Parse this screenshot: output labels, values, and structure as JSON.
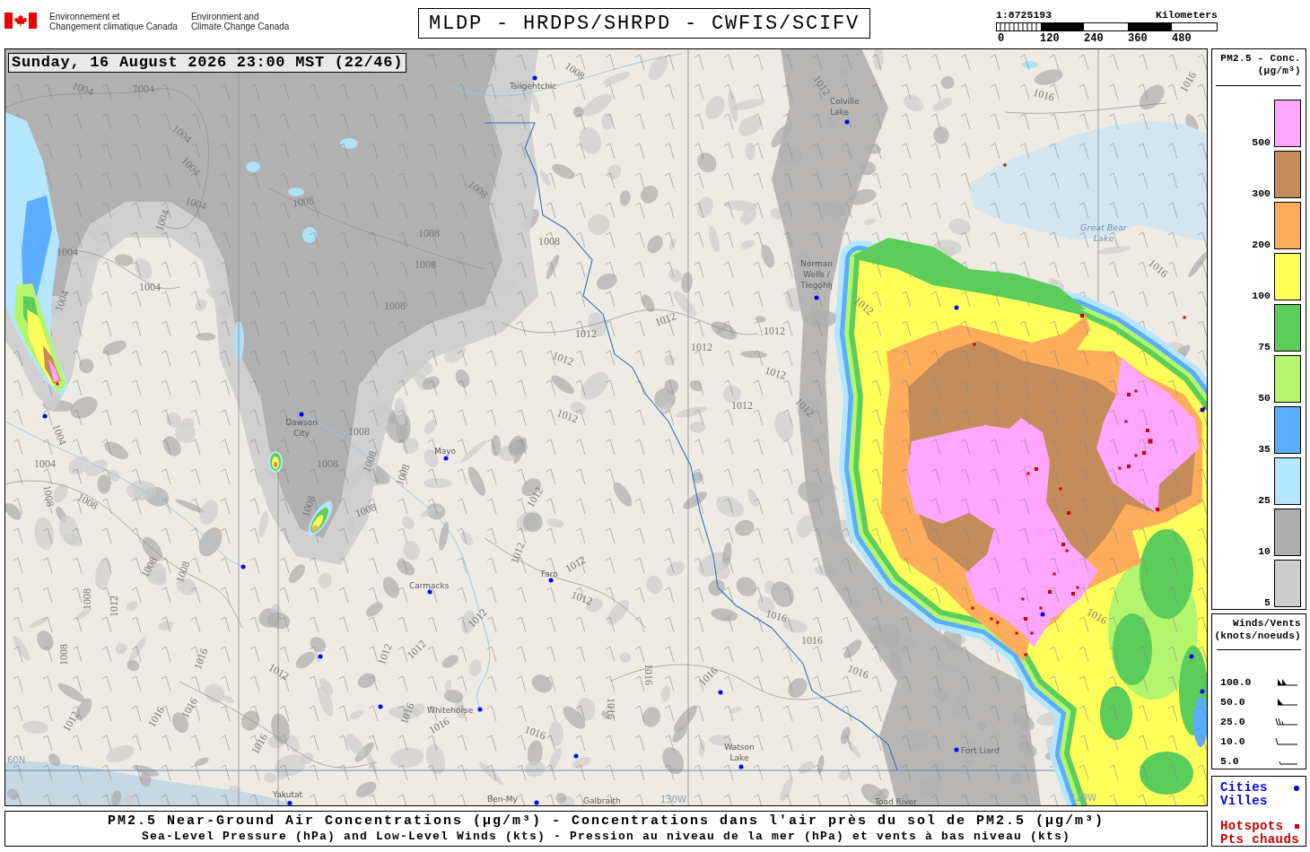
{
  "header": {
    "agency_names": [
      {
        "lines": [
          "Environnement et",
          "Changement climatique Canada"
        ]
      },
      {
        "lines": [
          "Environment and",
          "Climate Change Canada"
        ]
      }
    ],
    "title": "MLDP - HRDPS/SHRPD - CWFIS/SCIFV",
    "scale": {
      "ratio": "1:8725193",
      "unit": "Kilometers",
      "ticks": [
        "0",
        "120",
        "240",
        "360",
        "480"
      ]
    }
  },
  "map": {
    "timestamp": "Sunday, 16 August 2026 23:00 MST (22/46)",
    "places": [
      {
        "kind": "town",
        "lines": [
          "Tsiigehtchic"
        ]
      },
      {
        "kind": "town",
        "lines": [
          "Colville",
          "Lake"
        ]
      },
      {
        "kind": "lake",
        "lines": [
          "Great Bear",
          "Lake"
        ]
      },
      {
        "kind": "town",
        "lines": [
          "Norman",
          "Wells /",
          "Tłegǫ́hłı̨"
        ]
      },
      {
        "kind": "town",
        "lines": [
          "Dawson",
          "City"
        ]
      },
      {
        "kind": "town",
        "lines": [
          "Mayo"
        ]
      },
      {
        "kind": "town",
        "lines": [
          "Carmacks"
        ]
      },
      {
        "kind": "town",
        "lines": [
          "Faro"
        ]
      },
      {
        "kind": "town",
        "lines": [
          "Whitehorse"
        ]
      },
      {
        "kind": "town",
        "lines": [
          "Watson",
          "Lake"
        ]
      },
      {
        "kind": "town",
        "lines": [
          "Fort Liard"
        ]
      },
      {
        "kind": "graticule",
        "lines": [
          "60N"
        ]
      },
      {
        "kind": "town",
        "lines": [
          "Yakutat"
        ]
      },
      {
        "kind": "town",
        "lines": [
          "Ben-My"
        ]
      },
      {
        "kind": "town",
        "lines": [
          "Galbraith"
        ]
      },
      {
        "kind": "graticule",
        "lines": [
          "130W"
        ]
      },
      {
        "kind": "town",
        "lines": [
          "Toad River"
        ]
      },
      {
        "kind": "graticule",
        "lines": [
          "120W"
        ]
      }
    ],
    "isobar_labels": [
      "1008",
      "1004",
      "1004",
      "1004",
      "1004",
      "1004",
      "1004",
      "1004",
      "1004",
      "1004",
      "1008",
      "1008",
      "1008",
      "1008",
      "1008",
      "1008",
      "1012",
      "1016",
      "1016",
      "1016",
      "1012",
      "1012",
      "1012",
      "1012",
      "1012",
      "1012",
      "1012",
      "1012",
      "1012",
      "1012",
      "1008",
      "1004",
      "1008",
      "1008",
      "1008",
      "1004",
      "1008",
      "1008",
      "1012",
      "1008",
      "1008",
      "1012",
      "1012",
      "1008",
      "1008",
      "1012",
      "1008",
      "1012",
      "1016",
      "1012",
      "1016",
      "1016",
      "1012",
      "1012",
      "1008",
      "1016",
      "1012",
      "1016",
      "1016",
      "1016",
      "1016",
      "1016",
      "1016",
      "1016",
      "1012",
      "1016",
      "1016",
      "1016"
    ]
  },
  "caption": {
    "title": "PM2.5 Near-Ground Air Concentrations (µg/m³) - Concentrations dans l'air près du sol de PM2.5 (µg/m³)",
    "subtitle": "Sea-Level Pressure (hPa) and Low-Level Winds (kts) - Pression au niveau de la mer (hPa) et vents à bas niveau (kts)"
  },
  "concentration_legend": {
    "title": "PM2.5 - Conc.",
    "unit": "(µg/m³)",
    "bins": [
      {
        "label": "500",
        "color": "#ffa6ff"
      },
      {
        "label": "300",
        "color": "#c48c5a"
      },
      {
        "label": "200",
        "color": "#ffad5a"
      },
      {
        "label": "100",
        "color": "#ffff5a"
      },
      {
        "label": "75",
        "color": "#5acd5a"
      },
      {
        "label": "50",
        "color": "#b4f56e"
      },
      {
        "label": "35",
        "color": "#5aadff"
      },
      {
        "label": "25",
        "color": "#b4e6ff"
      },
      {
        "label": "10",
        "color": "#adadad"
      },
      {
        "label": "5",
        "color": "#cdcdcd"
      }
    ]
  },
  "wind_legend": {
    "title": "Winds/Vents",
    "unit": "(knots/noeuds)",
    "rows": [
      {
        "speed": "100.0",
        "kind": "pennant2"
      },
      {
        "speed": "50.0",
        "kind": "pennant"
      },
      {
        "speed": "25.0",
        "kind": "barbs2half"
      },
      {
        "speed": "10.0",
        "kind": "barb"
      },
      {
        "speed": "5.0",
        "kind": "halfbarb"
      }
    ]
  },
  "symbol_legend": [
    {
      "kind": "city",
      "labels": [
        "Cities",
        "Villes"
      ],
      "color": "#0000ff"
    },
    {
      "kind": "hotspot",
      "labels": [
        "Hotspots",
        "Pts chauds"
      ],
      "color": "#cc0000"
    }
  ]
}
